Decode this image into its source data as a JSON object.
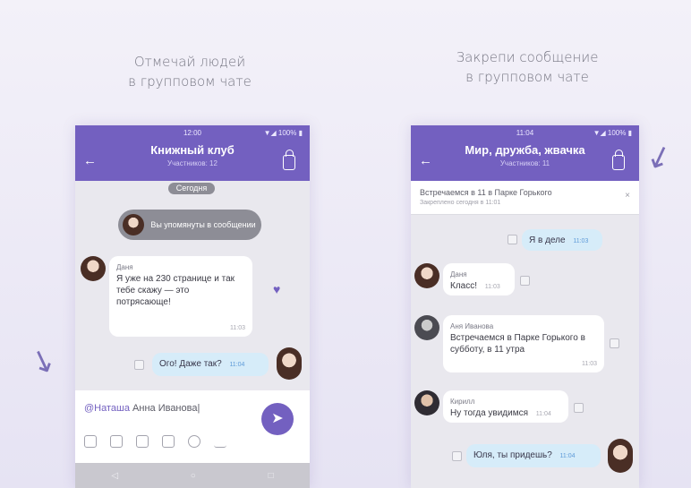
{
  "captions": {
    "left": [
      "Отмечай людей",
      "в групповом чате"
    ],
    "right": [
      "Закрепи сообщение",
      "в групповом чате"
    ]
  },
  "phone_left": {
    "status_time": "12:00",
    "status_right": "▼◢ 100% ▮",
    "title": "Книжный клуб",
    "subtitle": "Участников: 12",
    "date_pill": "Сегодня",
    "reply_pill": "Вы упомянуты в сообщении",
    "message": {
      "sender": "Даня",
      "text": "Я уже на 230 странице и так тебе скажу — это потрясающе!",
      "time": "11:03"
    },
    "outgoing": {
      "text": "Ого! Даже так?",
      "time": "11:04"
    },
    "compose": {
      "mention": "@Наташа",
      "text": "Анна Иванова"
    },
    "send_icon": "plane-icon",
    "nav": [
      "◁",
      "○",
      "□"
    ]
  },
  "phone_right": {
    "status_time": "11:04",
    "status_right": "▼◢ 100% ▮",
    "title": "Мир, дружба, жвачка",
    "subtitle": "Участников: 11",
    "pinned": {
      "title": "Встречаемся в 11 в Парке Горького",
      "meta": "Закреплено сегодня в 11:01",
      "close": "×"
    },
    "messages": [
      {
        "dir": "out",
        "text": "Я в деле",
        "time": "11:03"
      },
      {
        "dir": "in",
        "sender": "Даня",
        "text": "Класс!",
        "time": "11:03"
      },
      {
        "dir": "in",
        "sender": "Аня Иванова",
        "text": "Встречаемся в Парке Горького в субботу, в 11 утра",
        "time": "11:03"
      },
      {
        "dir": "in",
        "sender": "Кирилл",
        "text": "Ну тогда увидимся",
        "time": "11:04"
      },
      {
        "dir": "out",
        "text": "Юля, ты придешь?",
        "time": "11:04"
      }
    ]
  }
}
